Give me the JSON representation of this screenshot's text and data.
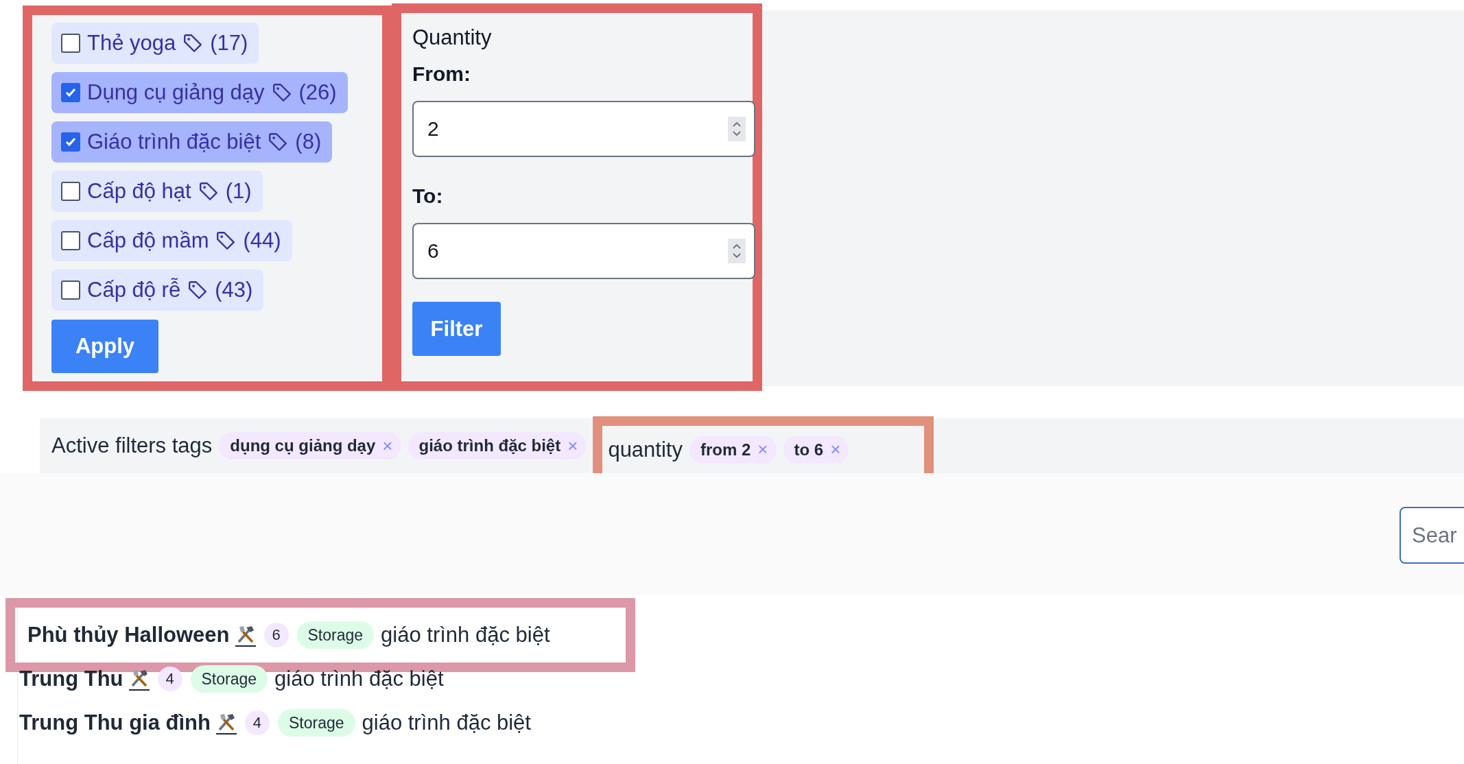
{
  "tag_filter": {
    "options": [
      {
        "label": "Thẻ yoga",
        "count": "(17)",
        "checked": false
      },
      {
        "label": "Dụng cụ giảng dạy",
        "count": "(26)",
        "checked": true
      },
      {
        "label": "Giáo trình đặc biệt",
        "count": "(8)",
        "checked": true
      },
      {
        "label": "Cấp độ hạt",
        "count": "(1)",
        "checked": false
      },
      {
        "label": "Cấp độ mầm",
        "count": "(44)",
        "checked": false
      },
      {
        "label": "Cấp độ rễ",
        "count": "(43)",
        "checked": false
      }
    ],
    "apply_button": "Apply"
  },
  "quantity_filter": {
    "title": "Quantity",
    "from_label": "From:",
    "from_value": "2",
    "to_label": "To:",
    "to_value": "6",
    "filter_button": "Filter"
  },
  "active_filters": {
    "label": "Active filters tags",
    "tags": [
      {
        "text": "dụng cụ giảng dạy",
        "remove": "×"
      },
      {
        "text": "giáo trình đặc biệt",
        "remove": "×"
      }
    ],
    "quantity_label": "quantity",
    "quantity_tags": [
      {
        "text": "from 2",
        "remove": "×"
      },
      {
        "text": "to 6",
        "remove": "×"
      }
    ]
  },
  "search": {
    "placeholder": "Sear"
  },
  "products": [
    {
      "name": "Phù thủy Halloween",
      "quantity": "6",
      "location": "Storage",
      "category": "giáo trình đặc biệt"
    },
    {
      "name": "Trung Thu",
      "quantity": "4",
      "location": "Storage",
      "category": "giáo trình đặc biệt"
    },
    {
      "name": "Trung Thu gia đình",
      "quantity": "4",
      "location": "Storage",
      "category": "giáo trình đặc biệt"
    }
  ]
}
